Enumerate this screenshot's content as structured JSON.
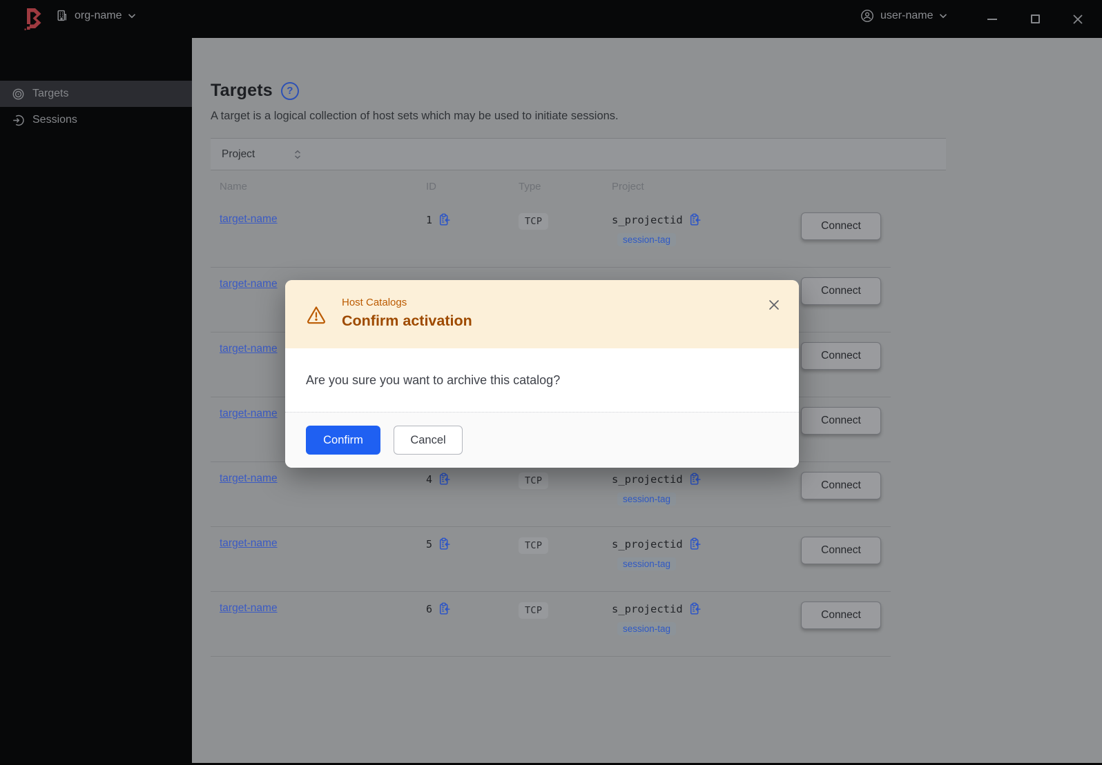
{
  "topbar": {
    "org_label": "org-name",
    "user_label": "user-name"
  },
  "sidebar": {
    "items": [
      {
        "label": "Targets",
        "icon": "target-icon",
        "active": true
      },
      {
        "label": "Sessions",
        "icon": "sessions-icon",
        "active": false
      }
    ]
  },
  "page": {
    "title": "Targets",
    "description": "A target is a logical collection of host sets which may be used to initiate sessions.",
    "help_glyph": "?"
  },
  "toolbar": {
    "filter_label": "Project"
  },
  "table": {
    "columns": [
      "Name",
      "ID",
      "Type",
      "Project"
    ],
    "rows": [
      {
        "name": "target-name",
        "id": "1",
        "type": "TCP",
        "project": "s_projectid",
        "tag": "session-tag",
        "connect": "Connect"
      },
      {
        "name": "target-name",
        "id": "",
        "type": "",
        "project": "",
        "tag": "",
        "connect": "Connect"
      },
      {
        "name": "target-name",
        "id": "",
        "type": "",
        "project": "",
        "tag": "",
        "connect": "Connect"
      },
      {
        "name": "target-name",
        "id": "",
        "type": "",
        "project": "",
        "tag": "",
        "connect": "Connect"
      },
      {
        "name": "target-name",
        "id": "4",
        "type": "TCP",
        "project": "s_projectid",
        "tag": "session-tag",
        "connect": "Connect"
      },
      {
        "name": "target-name",
        "id": "5",
        "type": "TCP",
        "project": "s_projectid",
        "tag": "session-tag",
        "connect": "Connect"
      },
      {
        "name": "target-name",
        "id": "6",
        "type": "TCP",
        "project": "s_projectid",
        "tag": "session-tag",
        "connect": "Connect"
      }
    ]
  },
  "modal": {
    "tagline": "Host Catalogs",
    "title": "Confirm activation",
    "body": "Are you sure you want to archive this catalog?",
    "confirm_label": "Confirm",
    "cancel_label": "Cancel"
  },
  "colors": {
    "brand_red": "#9e3a40",
    "accent_blue": "#1f60f2",
    "link_blue": "#3a5ac4",
    "warning_bg": "#fcf0d9",
    "warning_tagline": "#bb5a00",
    "warning_title": "#9e4a00"
  }
}
